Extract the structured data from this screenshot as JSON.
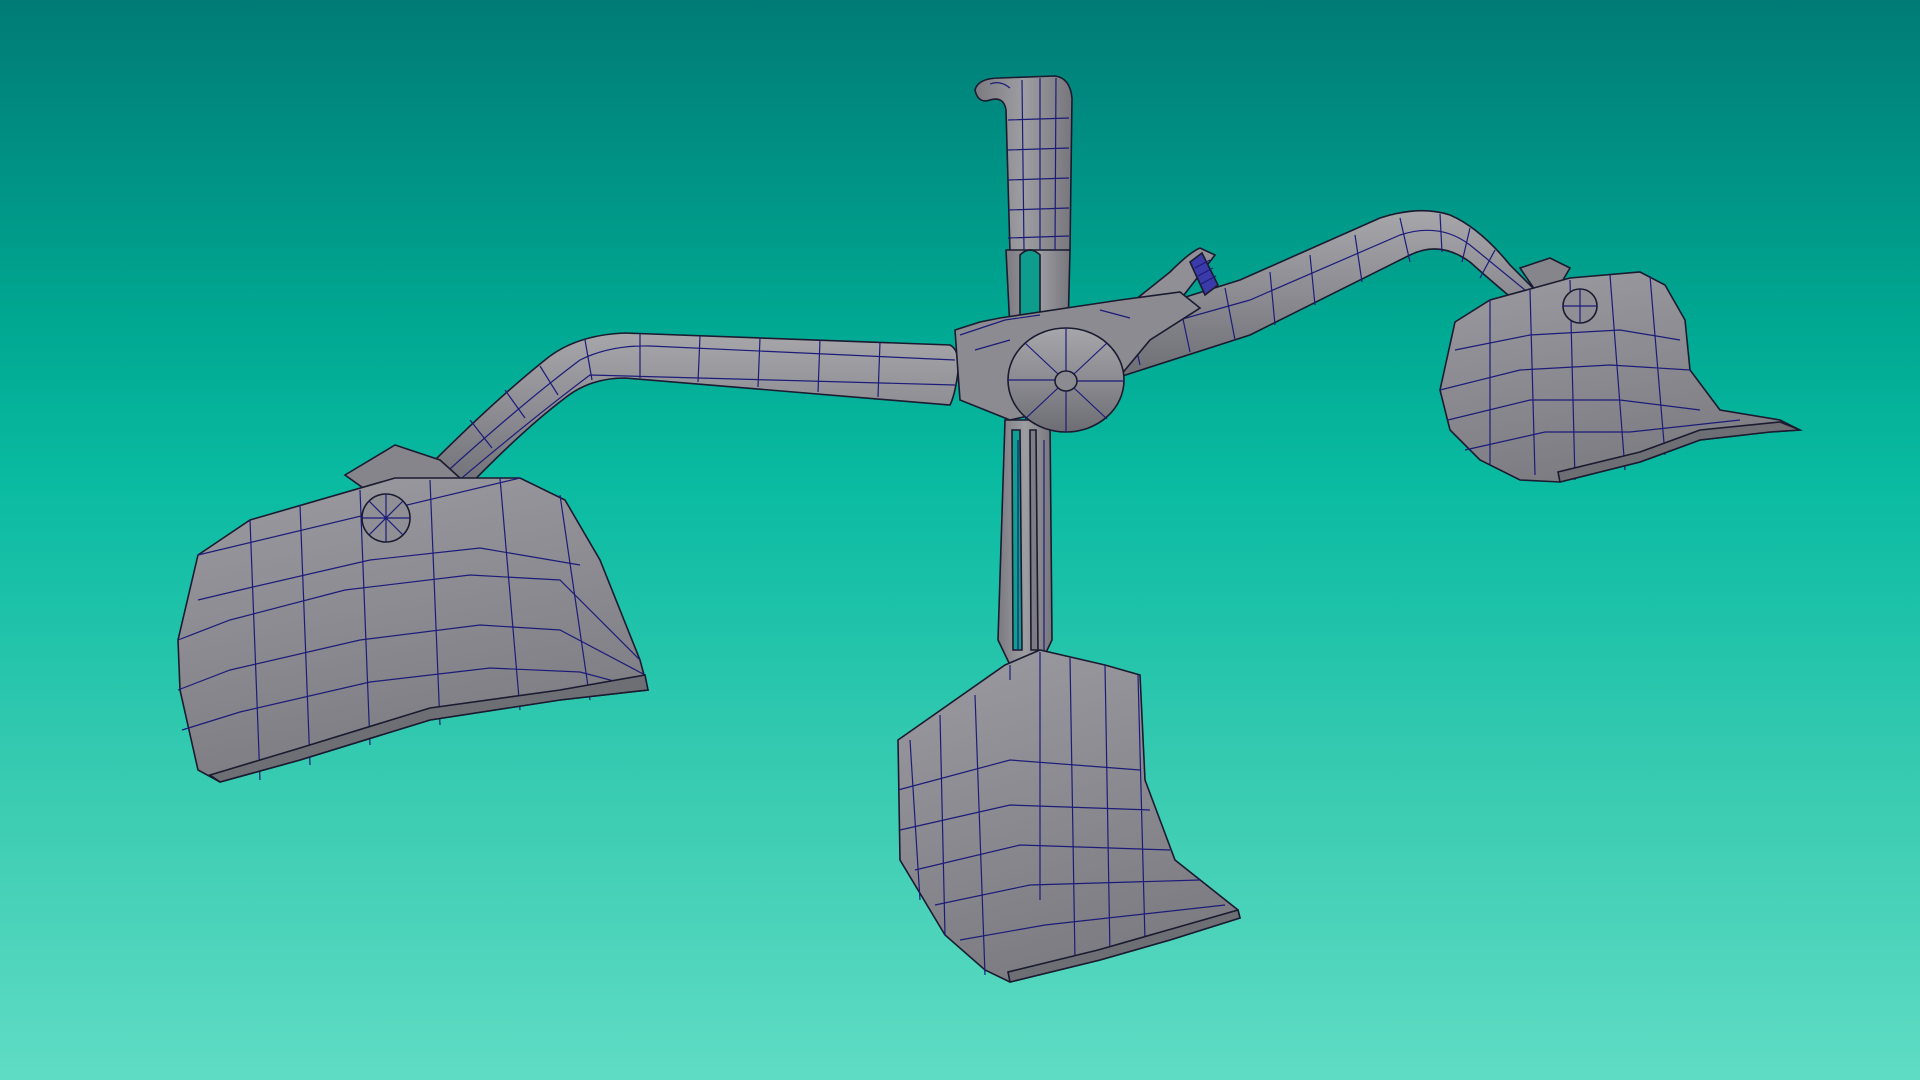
{
  "viewport": {
    "background_top": "#007b76",
    "background_bottom": "#5fdcc4"
  },
  "model": {
    "shading": "grey-smooth-with-wireframe",
    "surface_color": "#8c8c92",
    "wire_color": "#1c1b7a",
    "parts": [
      "top-hook",
      "vertical-shank",
      "center-hub",
      "left-arm",
      "right-arm",
      "lever",
      "left-blade",
      "center-blade",
      "right-blade"
    ]
  }
}
